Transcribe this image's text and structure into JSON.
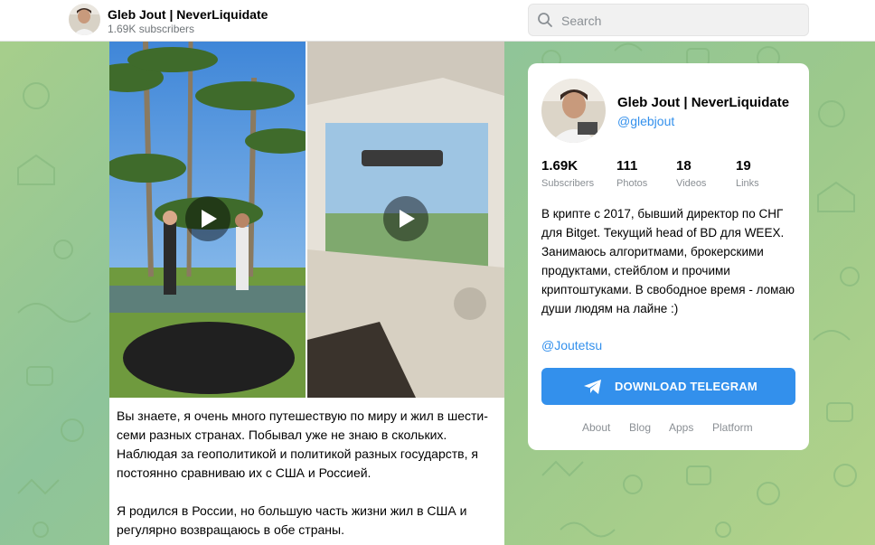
{
  "header": {
    "channel_title": "Gleb Jout | NeverLiquidate",
    "subscribers": "1.69K subscribers"
  },
  "search": {
    "placeholder": "Search"
  },
  "post": {
    "paragraphs": [
      "Вы знаете, я очень много путешествую по миру и жил в шести-семи разных странах. Побывал уже не знаю в скольких. Наблюдая за геополитикой и политикой разных государств, я постоянно сравниваю их с США и Россией.",
      "Я родился в России, но большую часть жизни жил в США и регулярно возвращаюсь в обе страны."
    ]
  },
  "channel_card": {
    "name": "Gleb Jout | NeverLiquidate",
    "handle": "@glebjout",
    "stats": [
      {
        "value": "1.69K",
        "label": "Subscribers"
      },
      {
        "value": "111",
        "label": "Photos"
      },
      {
        "value": "18",
        "label": "Videos"
      },
      {
        "value": "19",
        "label": "Links"
      }
    ],
    "description": "В крипте с 2017, бывший директор по СНГ для Bitget. Текущий head of BD для WEEX. Занимаюсь алгоритмами, брокерскими продуктами, стейблом и прочими криптоштуками. В свободное время - ломаю души людям на лайне :)",
    "link": "@Joutetsu",
    "download_button": "DOWNLOAD TELEGRAM",
    "footer_links": [
      "About",
      "Blog",
      "Apps",
      "Platform"
    ]
  },
  "colors": {
    "accent": "#3390ec",
    "muted_text": "#8a8f94",
    "background": "#9cc98c"
  }
}
